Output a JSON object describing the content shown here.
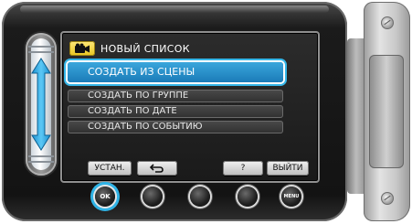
{
  "screen": {
    "title": "НОВЫЙ СПИСОК",
    "mode_icon": "video-camera-icon"
  },
  "menu": {
    "items": [
      {
        "label": "СОЗДАТЬ ИЗ СЦЕНЫ",
        "selected": true
      },
      {
        "label": "СОЗДАТЬ ПО ГРУППЕ",
        "selected": false
      },
      {
        "label": "СОЗДАТЬ ПО ДАТЕ",
        "selected": false
      },
      {
        "label": "СОЗДАТЬ ПО СОБЫТИЮ",
        "selected": false
      }
    ]
  },
  "soft_buttons": {
    "set_label": "УСТАН.",
    "back_icon": "return-arrow-icon",
    "help_label": "?",
    "exit_label": "ВЫЙТИ"
  },
  "physical_buttons": {
    "ok_label": "OK",
    "menu_label": "MENU",
    "active": "ok"
  },
  "colors": {
    "highlight": "#2fb3e6",
    "selected_item": "#1b7bb8",
    "badge": "#f2d33a"
  }
}
